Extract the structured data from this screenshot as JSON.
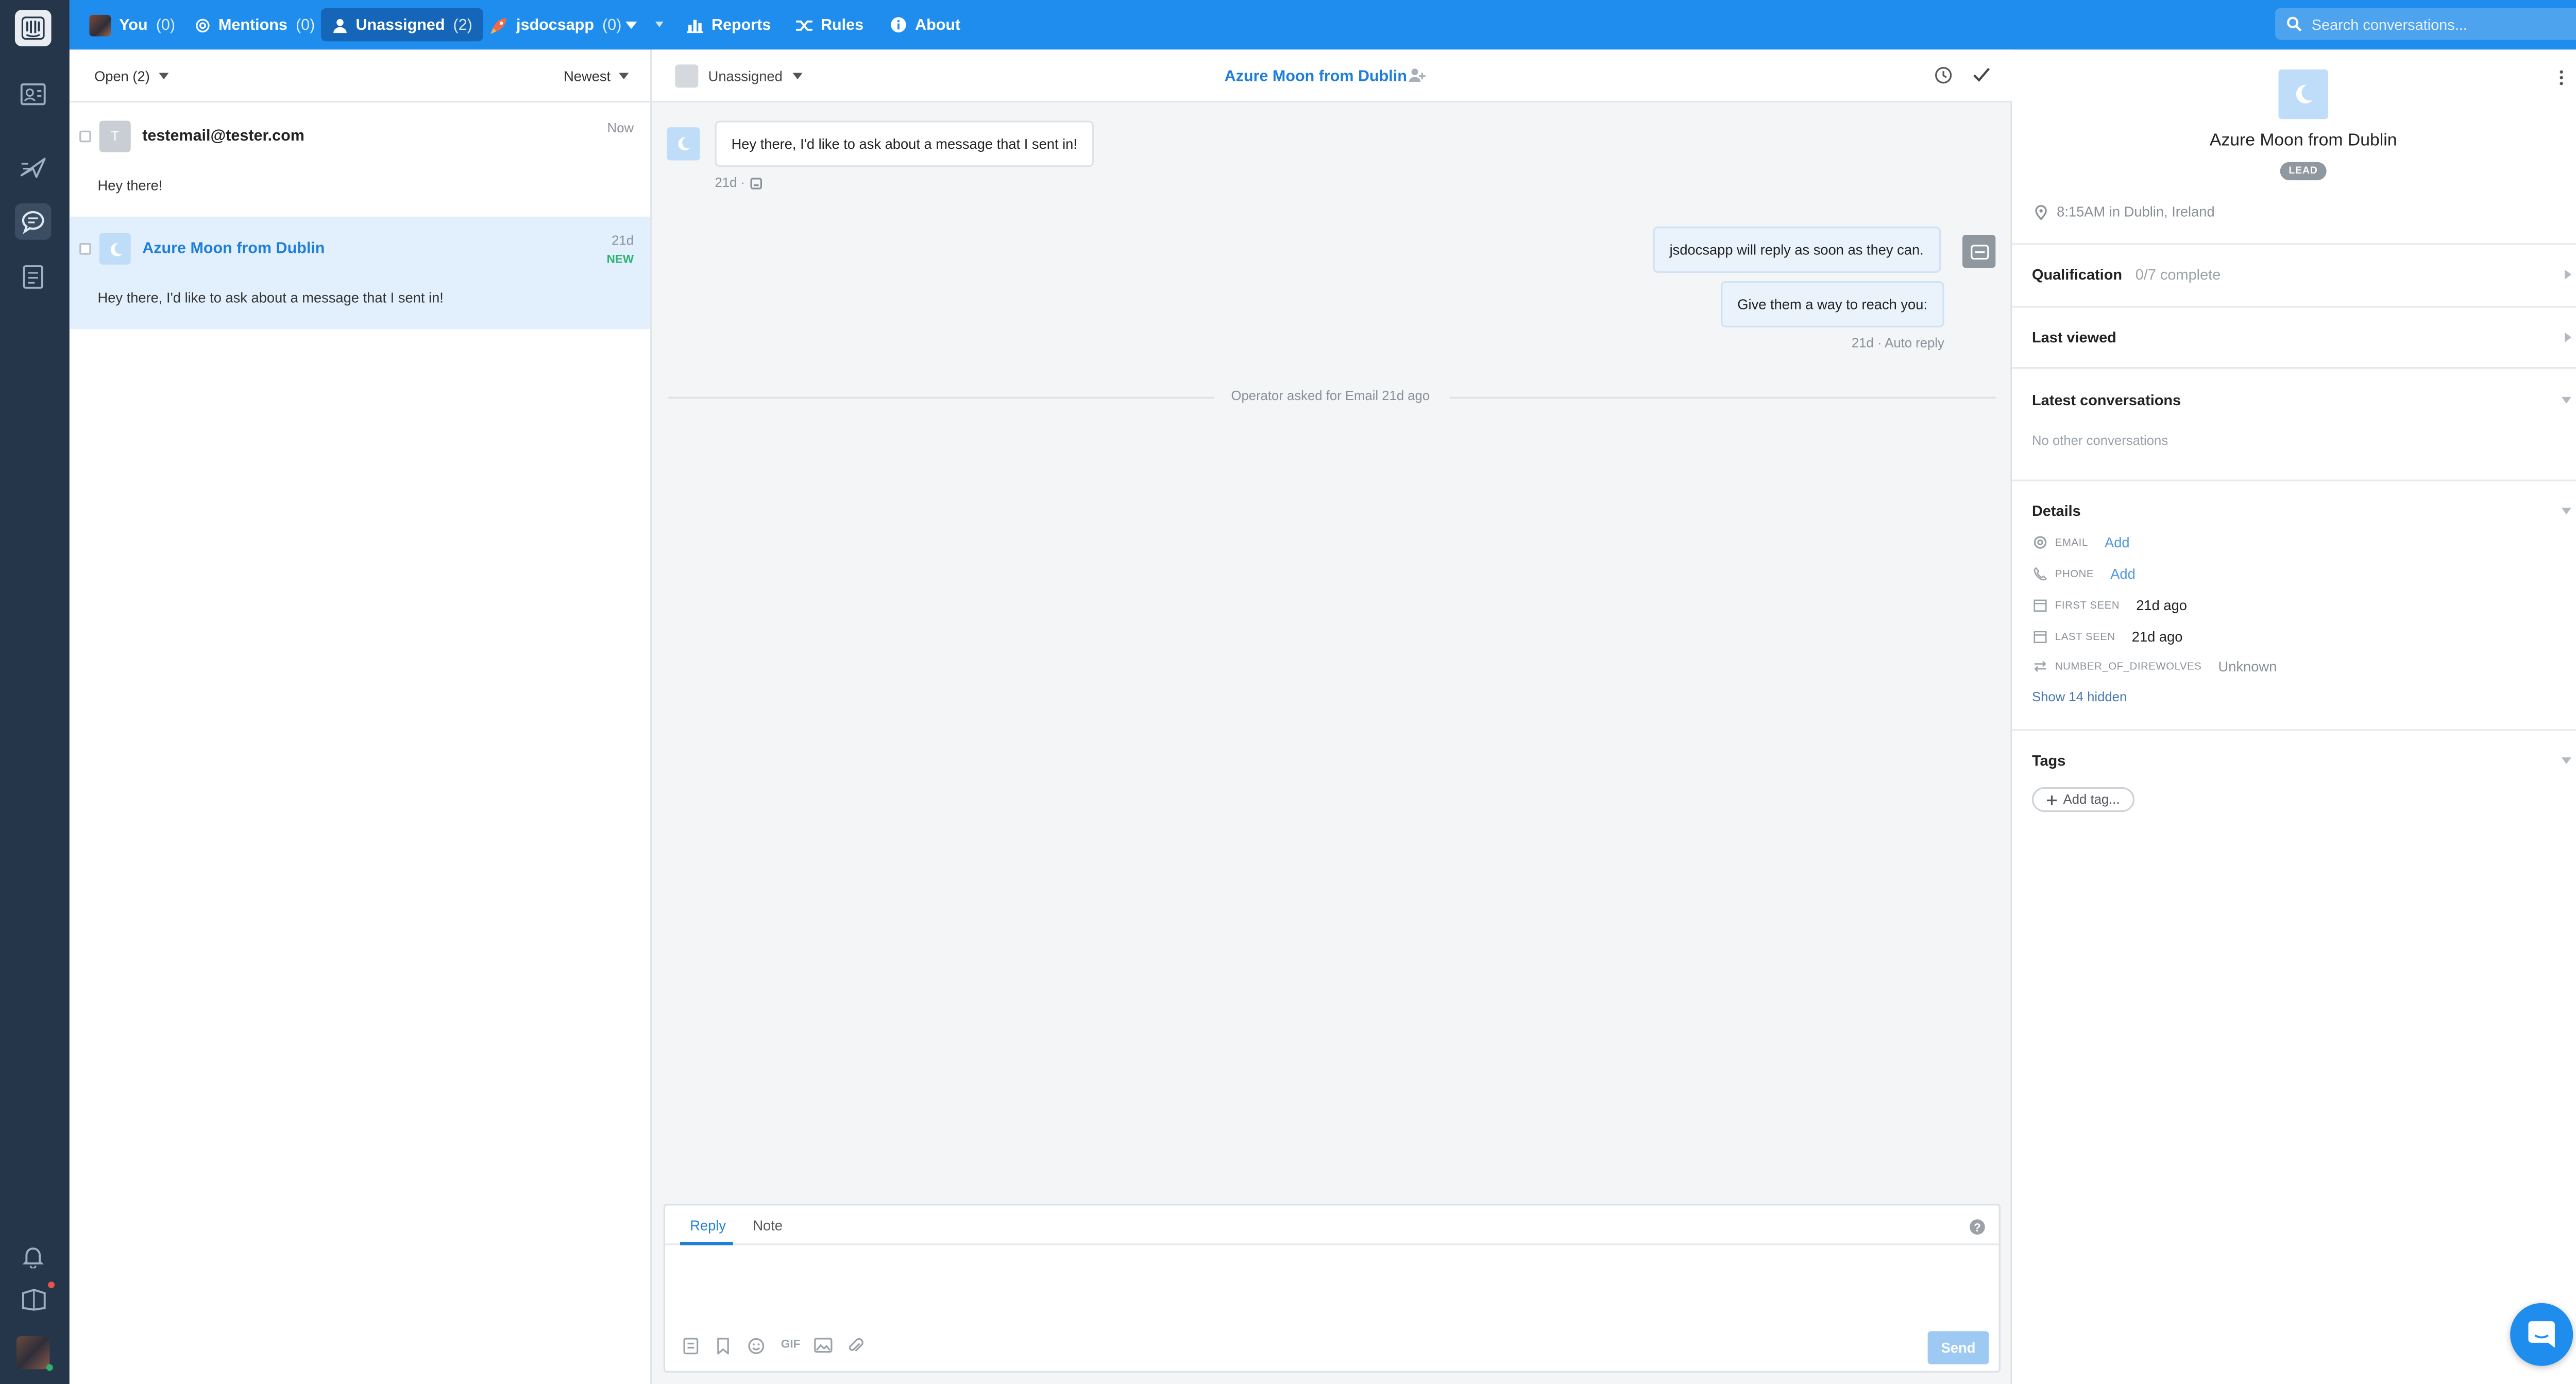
{
  "theme": {
    "accent": "#1f8ded",
    "rail": "#25364a",
    "new_badge": "#2db36e"
  },
  "topbar": {
    "you": {
      "label": "You",
      "count": "(0)"
    },
    "mentions": {
      "label": "Mentions",
      "count": "(0)"
    },
    "unassigned": {
      "label": "Unassigned",
      "count": "(2)"
    },
    "team": {
      "label": "jsdocsapp",
      "count": "(0)"
    },
    "reports": "Reports",
    "rules": "Rules",
    "about": "About",
    "search_placeholder": "Search conversations..."
  },
  "list": {
    "filter": "Open (2)",
    "sort": "Newest",
    "items": [
      {
        "avatar": "T",
        "name": "testemail@tester.com",
        "time": "Now",
        "preview": "Hey there!",
        "is_new": false
      },
      {
        "avatar": "moon-icon",
        "name": "Azure Moon from Dublin",
        "time": "21d",
        "badge": "NEW",
        "preview": "Hey there, I'd like to ask about a message that I sent in!",
        "is_new": true
      }
    ]
  },
  "conversation": {
    "assignee": "Unassigned",
    "title": "Azure Moon from Dublin",
    "messages": {
      "incoming": {
        "text": "Hey there, I'd like to ask about a message that I sent in!",
        "meta": "21d ·"
      },
      "auto1": "jsdocsapp will reply as soon as they can.",
      "auto2": "Give them a way to reach you:",
      "auto_meta": "21d · Auto reply"
    },
    "separator": "Operator asked for Email 21d ago"
  },
  "composer": {
    "tab_reply": "Reply",
    "tab_note": "Note",
    "gif": "GIF",
    "send": "Send"
  },
  "sidebar": {
    "name": "Azure Moon from Dublin",
    "badge": "LEAD",
    "location": "8:15AM in Dublin, Ireland",
    "qualification": {
      "title": "Qualification",
      "sub": "0/7 complete"
    },
    "last_viewed": "Last viewed",
    "latest": {
      "title": "Latest conversations",
      "empty": "No other conversations"
    },
    "details": {
      "title": "Details",
      "rows": [
        {
          "label": "EMAIL",
          "value": "Add"
        },
        {
          "label": "PHONE",
          "value": "Add"
        },
        {
          "label": "FIRST SEEN",
          "value": "21d ago"
        },
        {
          "label": "LAST SEEN",
          "value": "21d ago"
        },
        {
          "label": "NUMBER_OF_DIREWOLVES",
          "value": "Unknown"
        }
      ],
      "show_hidden": "Show 14 hidden"
    },
    "tags": {
      "title": "Tags",
      "add": "Add tag..."
    }
  }
}
